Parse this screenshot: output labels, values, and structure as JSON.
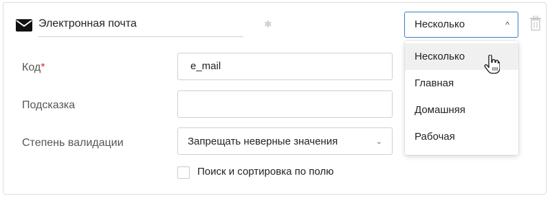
{
  "field": {
    "name": "Электронная почта",
    "icon": "envelope-icon",
    "required_marker": "*",
    "type_select": {
      "value": "Несколько",
      "options": [
        "Несколько",
        "Главная",
        "Домашняя",
        "Рабочая"
      ],
      "hovered": "Несколько"
    }
  },
  "form": {
    "code_label": "Код",
    "code_required": "*",
    "code_value": "e_mail",
    "hint_label": "Подсказка",
    "hint_value": "",
    "validation_label": "Степень валидации",
    "validation_value": "Запрещать неверные значения",
    "search_sort_label": "Поиск и сортировка по полю",
    "search_sort_checked": false
  },
  "colors": {
    "accent": "#3a78c8",
    "required": "#d32f2f"
  }
}
